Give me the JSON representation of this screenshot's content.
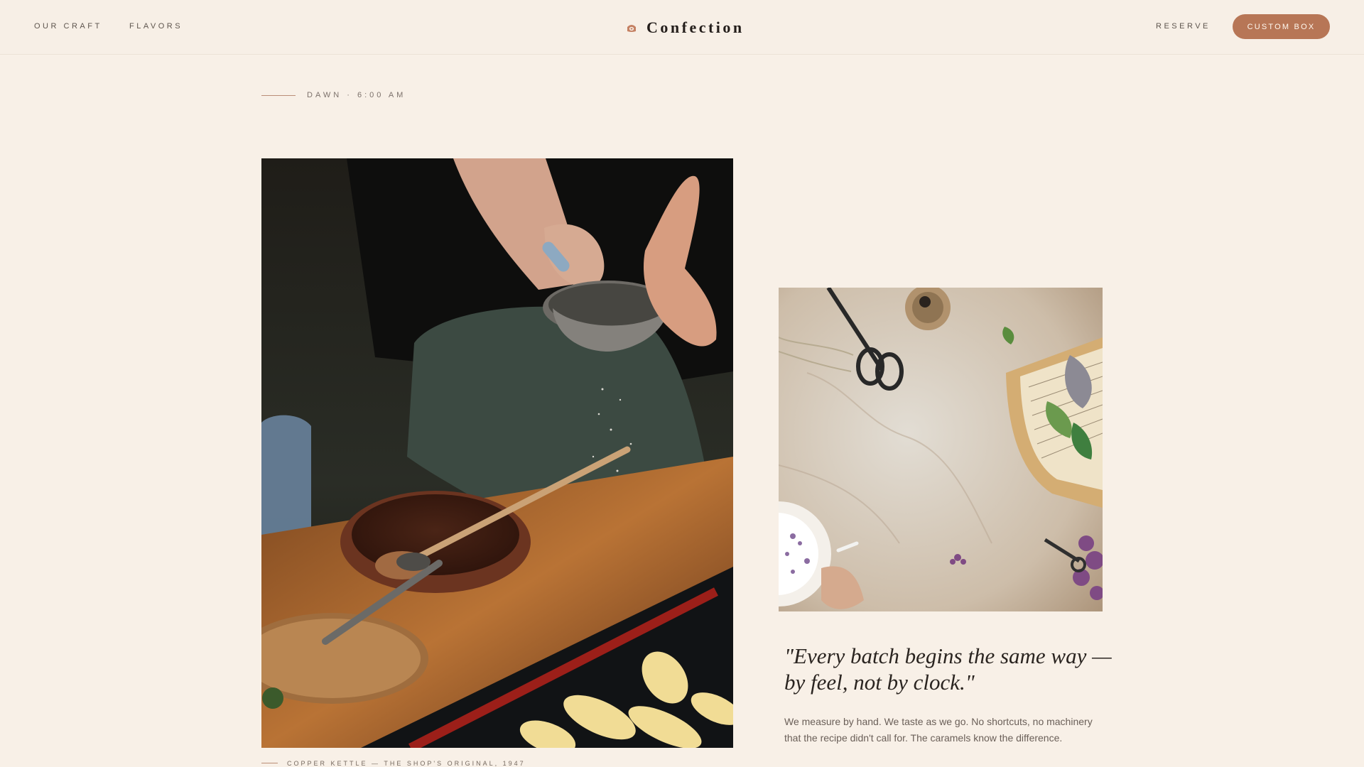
{
  "header": {
    "nav_left": [
      "OUR CRAFT",
      "FLAVORS"
    ],
    "brand": "Confection",
    "brand_icon": "copper-pot-icon",
    "reserve_label": "RESERVE",
    "custom_box_label": "CUSTOM BOX"
  },
  "main": {
    "timestamp": "DAWN · 6:00 AM",
    "hero_photo": {
      "description": "hands sifting powdered sugar over a mixing bowl and tray of piped pastries",
      "caption": "COPPER KETTLE — THE SHOP'S ORIGINAL, 1947"
    },
    "side_photo": {
      "description": "flat lay with scissors, twine, basket, sheet music and lilac sprig"
    },
    "quote": "\"Every batch begins the same way — by feel, not by clock.\"",
    "body": "We measure by hand. We taste as we go. No shortcuts, no machinery that the recipe didn't call for. The caramels know the difference."
  },
  "colors": {
    "background": "#f8f0e7",
    "accent": "#b77656",
    "text": "#2a2420",
    "muted": "#7c716b"
  }
}
